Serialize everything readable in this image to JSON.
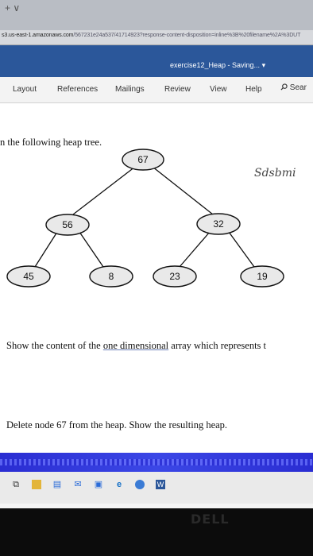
{
  "browser": {
    "new_tab": "+ ∨",
    "url_host": "s3.us-east-1.amazonaws.com",
    "url_path": "/567231e24a537/41714923?response-content-disposition=inline%3B%20filename%2A%3DUT"
  },
  "word": {
    "doc_title": "exercise12_Heap - Saving... ▾",
    "ribbon_tabs": [
      "Layout",
      "References",
      "Mailings",
      "Review",
      "View",
      "Help"
    ],
    "search_label": "Sear",
    "title_bar_color": "#2b579a"
  },
  "document": {
    "heading": "n the following heap tree.",
    "handwritten_note": "Sdsbmi",
    "q1_before": "Show the content of the ",
    "q1_underlined": "one dimensional",
    "q1_after": " array which represents t",
    "q2": "Delete node 67 from the heap. Show the resulting heap."
  },
  "heap_tree": {
    "nodes": [
      {
        "id": "root",
        "value": "67"
      },
      {
        "id": "left",
        "value": "56"
      },
      {
        "id": "right",
        "value": "32"
      },
      {
        "id": "left-left",
        "value": "45"
      },
      {
        "id": "left-right",
        "value": "8"
      },
      {
        "id": "right-left",
        "value": "23"
      },
      {
        "id": "right-right",
        "value": "19"
      }
    ],
    "node_fill": "#e9e9e9"
  },
  "taskbar": {
    "icons": [
      "task-view-icon",
      "file-explorer-icon",
      "store-icon",
      "mail-icon",
      "photos-icon",
      "edge-icon",
      "chrome-icon",
      "word-icon"
    ]
  },
  "monitor": {
    "brand": "DELL"
  }
}
